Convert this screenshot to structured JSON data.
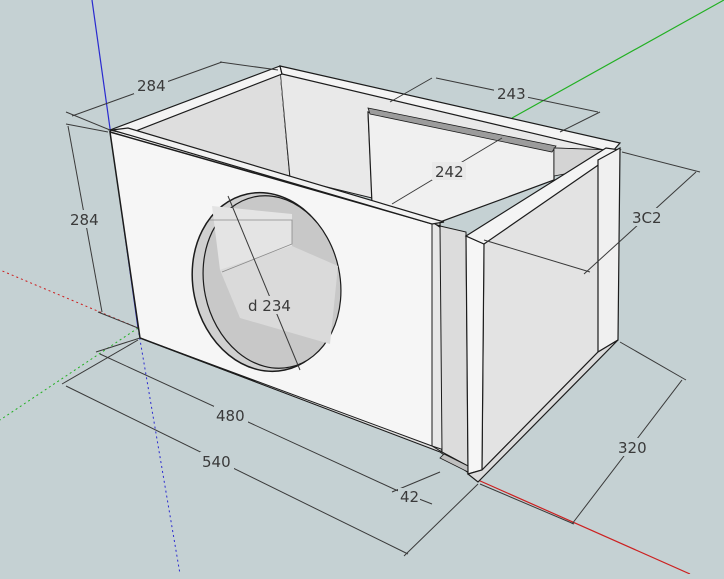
{
  "colors": {
    "background": "#c5d1d3",
    "panel_light": "#f4f4f4",
    "panel_mid": "#dedede",
    "panel_dark": "#c9c9c9",
    "edge": "#1c1c1c",
    "dimension": "#3a3a3a",
    "axis_blue": "#2a2ad0",
    "axis_green": "#22b022",
    "axis_red": "#cc2020"
  },
  "dimensions": {
    "top_depth": "284",
    "inner_depth": "243",
    "height_left": "284",
    "partition_width": "242",
    "port_height": "3C2",
    "hole_diameter": "d 234",
    "inner_width": "480",
    "outer_width": "540",
    "port_gap": "42",
    "port_depth": "320"
  }
}
